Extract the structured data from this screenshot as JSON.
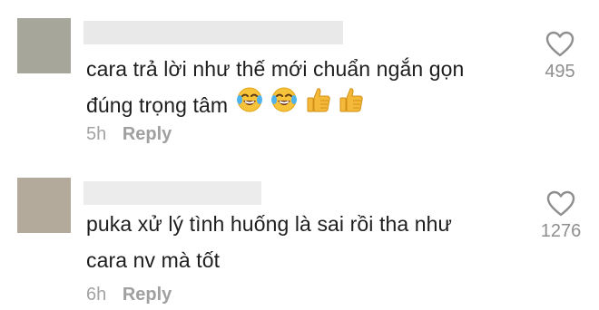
{
  "comments": [
    {
      "line1": "cara trả lời như thế mới chuẩn ngắn gọn",
      "line2": "đúng trọng tâm",
      "emojis": [
        "face-with-tears-of-joy",
        "face-with-tears-of-joy",
        "thumbs-up",
        "thumbs-up"
      ],
      "time": "5h",
      "reply_label": "Reply",
      "likes": "495"
    },
    {
      "line1": "puka xử lý tình huống là sai rồi tha như",
      "line2": "cara nv mà tốt",
      "time": "6h",
      "reply_label": "Reply",
      "likes": "1276"
    }
  ],
  "colors": {
    "avatar1": "#a6a69a",
    "avatar2": "#b4aa9b",
    "redacted_username": "#e9e9e9",
    "meta_text": "#a3a3a3",
    "heart_outline": "#8e8e8e"
  }
}
